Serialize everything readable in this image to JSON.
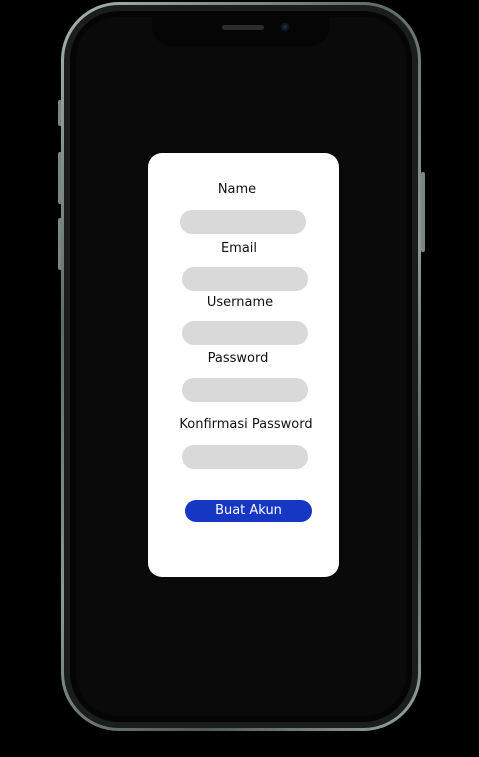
{
  "form": {
    "fields": [
      {
        "label": "Name",
        "value": "",
        "placeholder": ""
      },
      {
        "label": "Email",
        "value": "",
        "placeholder": ""
      },
      {
        "label": "Username",
        "value": "",
        "placeholder": ""
      },
      {
        "label": "Password",
        "value": "",
        "placeholder": ""
      },
      {
        "label": "Konfirmasi Password",
        "value": "",
        "placeholder": ""
      }
    ],
    "submit_label": "Buat Akun"
  },
  "colors": {
    "background": "#000000",
    "card": "#ffffff",
    "input_fill": "#d9d9d9",
    "button": "#1537c4",
    "button_text": "#ffffff"
  },
  "icons": {
    "earpiece": "speaker-icon",
    "front_camera": "camera-icon"
  }
}
